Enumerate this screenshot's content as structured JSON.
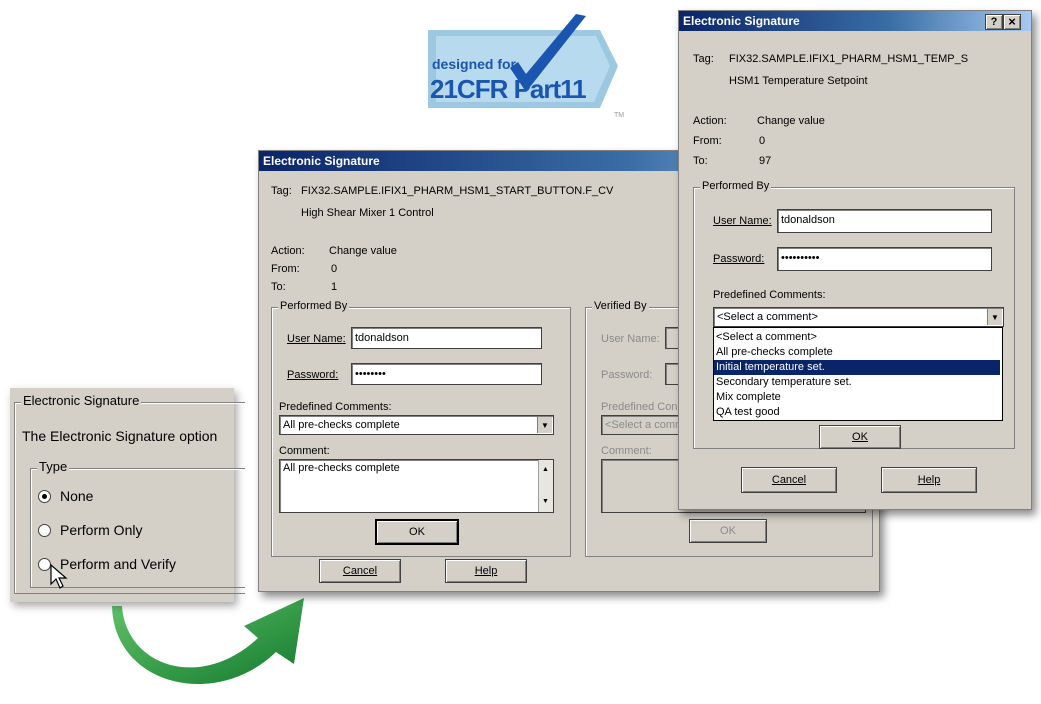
{
  "logo": {
    "line1": "designed for",
    "line2": "21CFR Part11",
    "tm": "TM"
  },
  "options_panel": {
    "group_title": "Electronic Signature",
    "description": "The Electronic Signature option",
    "type_group": "Type",
    "options": [
      "None",
      "Perform Only",
      "Perform and Verify"
    ],
    "selected": "None"
  },
  "dialog_main": {
    "title": "Electronic Signature",
    "tag_label": "Tag:",
    "tag_value": "FIX32.SAMPLE.IFIX1_PHARM_HSM1_START_BUTTON.F_CV",
    "tag_desc": "High Shear Mixer 1 Control",
    "action_label": "Action:",
    "action_value": "Change value",
    "from_label": "From:",
    "from_value": "0",
    "to_label": "To:",
    "to_value": "1",
    "performed_group": "Performed By",
    "username_label": "User Name:",
    "username_value": "tdonaldson",
    "password_label": "Password:",
    "password_value": "••••••••",
    "comments_label": "Predefined Comments:",
    "comments_selected": "All pre-checks complete",
    "comment_label": "Comment:",
    "comment_value": "All pre-checks complete",
    "ok": "OK",
    "verified_group": "Verified By",
    "v_username_label": "User Name:",
    "v_password_label": "Password:",
    "v_comments_label": "Predefined Con",
    "v_comments_selected": "<Select a comm",
    "v_comment_label": "Comment:",
    "v_ok": "OK",
    "cancel": "Cancel",
    "help": "Help"
  },
  "dialog_top": {
    "title": "Electronic Signature",
    "help_btn": "?",
    "close_btn": "×",
    "tag_label": "Tag:",
    "tag_value": "FIX32.SAMPLE.IFIX1_PHARM_HSM1_TEMP_S",
    "tag_desc": "HSM1 Temperature Setpoint",
    "action_label": "Action:",
    "action_value": "Change value",
    "from_label": "From:",
    "from_value": "0",
    "to_label": "To:",
    "to_value": "97",
    "performed_group": "Performed By",
    "username_label": "User Name:",
    "username_value": "tdonaldson",
    "password_label": "Password:",
    "password_value": "••••••••••",
    "comments_label": "Predefined Comments:",
    "comments_selected": "<Select a comment>",
    "dropdown_items": [
      "<Select a comment>",
      "All pre-checks complete",
      "Initial temperature set.",
      "Secondary temperature set.",
      "Mix complete",
      "QA test good"
    ],
    "highlighted_index": 2,
    "ok": "OK",
    "cancel": "Cancel",
    "help": "Help"
  },
  "colors": {
    "titlebar": "#0a246a",
    "dialog_bg": "#d4d0c8",
    "highlight": "#0a246a",
    "arrow": "#1f9a3c",
    "logo_blue": "#1a55b0",
    "logo_bg": "#7fb6d8"
  }
}
